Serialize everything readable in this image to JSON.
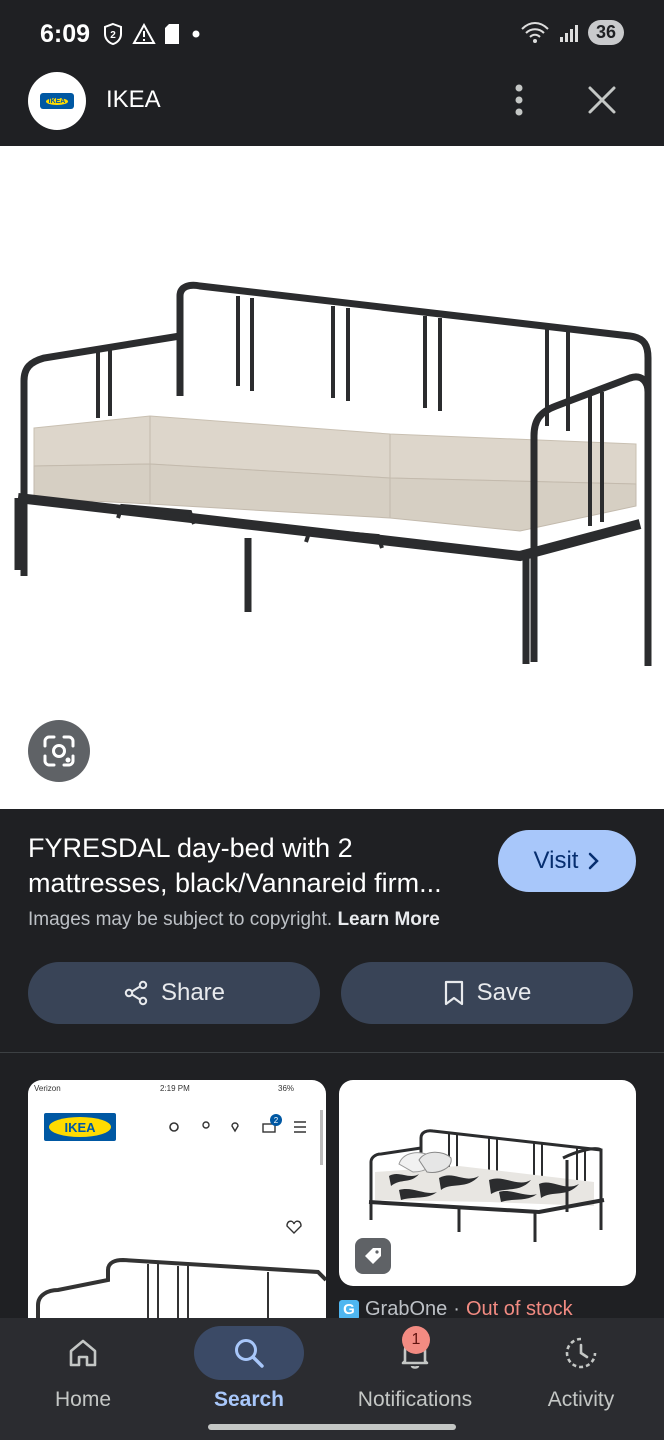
{
  "status_bar": {
    "time": "6:09",
    "battery": "36",
    "left_icons": [
      "data-saver-icon",
      "warning-icon",
      "sd-card-icon",
      "dot-icon"
    ],
    "right_icons": [
      "wifi-icon",
      "signal-icon"
    ]
  },
  "header": {
    "site_name": "IKEA",
    "logo_text": "IKEA"
  },
  "result": {
    "title_line1": "FYRESDAL day-bed with 2",
    "title_line2": "mattresses, black/Vannareid firm...",
    "visit_label": "Visit",
    "copyright_text": "Images may be subject to copyright.",
    "learn_more": "Learn More",
    "share_label": "Share",
    "save_label": "Save"
  },
  "related": {
    "thumb1": {
      "carrier": "Verizon",
      "time": "2:19 PM",
      "battery": "36%",
      "logo": "IKEA",
      "cart_count": "2"
    },
    "thumb2": {
      "source": "GrabOne",
      "separator": "·",
      "stock_status": "Out of stock"
    }
  },
  "bottom_nav": {
    "items": [
      {
        "label": "Home",
        "icon": "home-icon"
      },
      {
        "label": "Search",
        "icon": "search-icon",
        "active": true
      },
      {
        "label": "Notifications",
        "icon": "bell-icon",
        "badge": "1"
      },
      {
        "label": "Activity",
        "icon": "activity-icon"
      }
    ]
  },
  "colors": {
    "background": "#1f2023",
    "visit_button": "#a8c7fa",
    "action_button": "#394457",
    "out_of_stock": "#f28b82",
    "nav_active": "#a8c7fa"
  }
}
